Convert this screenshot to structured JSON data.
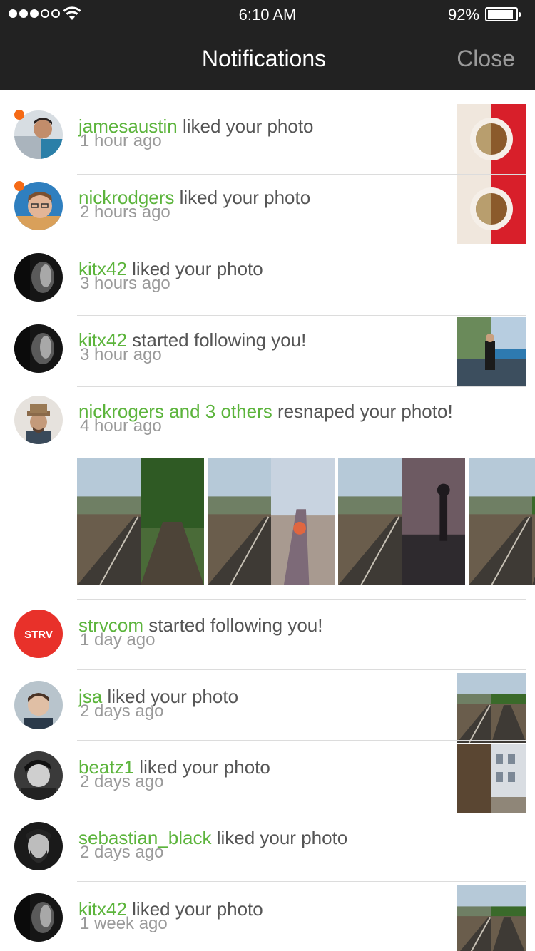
{
  "status": {
    "time": "6:10 AM",
    "battery": "92%",
    "battery_level": 0.92
  },
  "nav": {
    "title": "Notifications",
    "close_label": "Close"
  },
  "notifications": [
    {
      "user": "jamesaustin",
      "text": " liked your photo",
      "time": "1 hour ago",
      "unread": true,
      "avatar": "avatar-jamesaustin",
      "thumb": "coffee-photo"
    },
    {
      "user": "nickrodgers",
      "text": " liked your photo",
      "time": "2 hours ago",
      "unread": true,
      "avatar": "avatar-nickrodgers",
      "thumb": "coffee-photo"
    },
    {
      "user": "kitx42",
      "text": " liked your photo",
      "time": "3 hours ago",
      "unread": false,
      "avatar": "avatar-kitx42",
      "thumb": ""
    },
    {
      "user": "kitx42",
      "text": " started following you!",
      "time": "3 hour ago",
      "unread": false,
      "avatar": "avatar-kitx42",
      "thumb": "lake-photo"
    },
    {
      "user": "nickrogers and 3 others",
      "text": " resnaped your photo!",
      "time": "4 hour ago",
      "unread": false,
      "avatar": "avatar-nickrogers",
      "thumb": ""
    },
    {
      "user": "strvcom",
      "text": " started following you!",
      "time": "1 day ago",
      "unread": false,
      "avatar": "avatar-strv",
      "avatar_label": "STRV",
      "thumb": ""
    },
    {
      "user": "jsa",
      "text": " liked your photo",
      "time": "2 days  ago",
      "unread": false,
      "avatar": "avatar-jsa",
      "thumb": "tracks-photo"
    },
    {
      "user": "beatz1",
      "text": " liked your photo",
      "time": "2 days ago",
      "unread": false,
      "avatar": "avatar-beatz1",
      "thumb": "street-photo"
    },
    {
      "user": "sebastian_black",
      "text": " liked your photo",
      "time": "2 days ago",
      "unread": false,
      "avatar": "avatar-sebastian",
      "thumb": ""
    },
    {
      "user": "kitx42",
      "text": " liked your photo",
      "time": "1 week ago",
      "unread": false,
      "avatar": "avatar-kitx42",
      "thumb": "tracks-photo"
    }
  ],
  "resnap_photos": [
    "tracks-forest-photo",
    "tracks-beach-photo",
    "tracks-city-photo",
    "tracks-photo"
  ],
  "colors": {
    "accent": "#5cb43c",
    "unread": "#f56a16",
    "topbar": "#222222",
    "strv_red": "#e8312a"
  }
}
